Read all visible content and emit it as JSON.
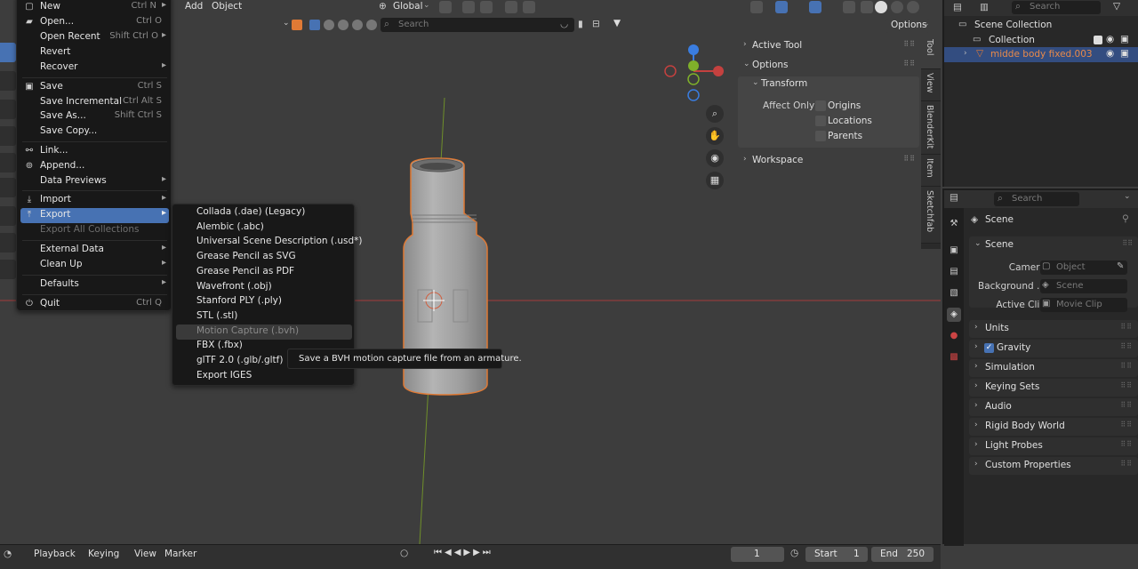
{
  "header": {
    "add": "Add",
    "object": "Object",
    "orientation": "Global",
    "options": "Options",
    "viewport_search_placeholder": "Search"
  },
  "file_menu": {
    "items": [
      {
        "label": "New",
        "shortcut": "Ctrl N",
        "arrow": "▸"
      },
      {
        "label": "Open...",
        "shortcut": "Ctrl O",
        "arrow": ""
      },
      {
        "label": "Open Recent",
        "shortcut": "Shift Ctrl O",
        "arrow": "▸"
      },
      {
        "label": "Revert",
        "shortcut": "",
        "arrow": ""
      },
      {
        "label": "Recover",
        "shortcut": "",
        "arrow": "▸"
      },
      {
        "label": "Save",
        "shortcut": "Ctrl S",
        "arrow": ""
      },
      {
        "label": "Save Incremental",
        "shortcut": "Ctrl Alt S",
        "arrow": ""
      },
      {
        "label": "Save As...",
        "shortcut": "Shift Ctrl S",
        "arrow": ""
      },
      {
        "label": "Save Copy...",
        "shortcut": "",
        "arrow": ""
      },
      {
        "label": "Link...",
        "shortcut": "",
        "arrow": ""
      },
      {
        "label": "Append...",
        "shortcut": "",
        "arrow": ""
      },
      {
        "label": "Data Previews",
        "shortcut": "",
        "arrow": "▸"
      },
      {
        "label": "Import",
        "shortcut": "",
        "arrow": "▸"
      },
      {
        "label": "Export",
        "shortcut": "",
        "arrow": "▸"
      },
      {
        "label": "Export All Collections",
        "shortcut": "",
        "arrow": ""
      },
      {
        "label": "External Data",
        "shortcut": "",
        "arrow": "▸"
      },
      {
        "label": "Clean Up",
        "shortcut": "",
        "arrow": "▸"
      },
      {
        "label": "Defaults",
        "shortcut": "",
        "arrow": "▸"
      },
      {
        "label": "Quit",
        "shortcut": "Ctrl Q",
        "arrow": ""
      }
    ]
  },
  "export_menu": {
    "items": [
      "Collada (.dae) (Legacy)",
      "Alembic (.abc)",
      "Universal Scene Description (.usd*)",
      "Grease Pencil as SVG",
      "Grease Pencil as PDF",
      "Wavefront (.obj)",
      "Stanford PLY (.ply)",
      "STL (.stl)",
      "Motion Capture (.bvh)",
      "FBX (.fbx)",
      "glTF 2.0 (.glb/.gltf)",
      "Export IGES"
    ],
    "tooltip": "Save a BVH motion capture file from an armature."
  },
  "n_panel": {
    "active_tool": "Active Tool",
    "options": "Options",
    "transform": "Transform",
    "affect_only": "Affect Only",
    "origins": "Origins",
    "locations": "Locations",
    "parents": "Parents",
    "workspace": "Workspace",
    "tabs": [
      "Tool",
      "View",
      "BlenderKit",
      "Item",
      "Sketchfab"
    ]
  },
  "outliner": {
    "search_placeholder": "Search",
    "scene_collection": "Scene Collection",
    "collection": "Collection",
    "object": "midde body fixed.003"
  },
  "properties": {
    "search_placeholder": "Search",
    "context": "Scene",
    "panel_title": "Scene",
    "camera_label": "Camera",
    "camera_value": "Object",
    "background_label": "Background ...",
    "background_value": "Scene",
    "active_clip_label": "Active Clip",
    "active_clip_value": "Movie Clip",
    "sections": [
      "Units",
      "Gravity",
      "Simulation",
      "Keying Sets",
      "Audio",
      "Rigid Body World",
      "Light Probes",
      "Custom Properties"
    ]
  },
  "timeline": {
    "playback": "Playback",
    "keying": "Keying",
    "view": "View",
    "marker": "Marker",
    "current_frame": "1",
    "start_label": "Start",
    "start_value": "1",
    "end_label": "End",
    "end_value": "250"
  },
  "colors": {
    "accent": "#4772b3",
    "selection_outline": "#e07a35",
    "x_axis": "#c4413f",
    "y_axis": "#7fb02a",
    "z_axis": "#3a7de0"
  }
}
